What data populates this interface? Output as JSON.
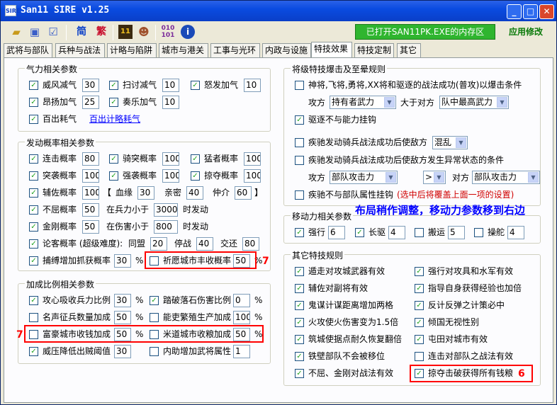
{
  "window": {
    "title": "San11 SIRE v1.25",
    "icon_text": "SIRE"
  },
  "toolbar": {
    "status": "已打开SAN11PK.EXE的内存区",
    "apply_label": "应用修改",
    "icons": [
      "open-folder-icon",
      "save-icon",
      "checklist-icon",
      "simplified-icon",
      "traditional-icon",
      "san11-icon",
      "character-icon",
      "binary-icon",
      "info-icon"
    ],
    "simp_label": "简",
    "trad_label": "繁"
  },
  "tabs": [
    "武将与部队",
    "兵种与战法",
    "计略与陷阱",
    "城市与港关",
    "工事与光环",
    "内政与设施",
    "特技效果",
    "特技定制",
    "其它"
  ],
  "g1": {
    "title": "气力相关参数",
    "row1": [
      {
        "label": "威风减气",
        "value": "30"
      },
      {
        "label": "扫讨减气",
        "value": "10"
      },
      {
        "label": "怒发加气",
        "value": "10"
      }
    ],
    "row2": [
      {
        "label": "昂扬加气",
        "value": "25"
      },
      {
        "label": "奏乐加气",
        "value": "10"
      }
    ],
    "row3": {
      "label": "百出耗气",
      "link": "百出计略耗气"
    }
  },
  "g2": {
    "title": "发动概率相关参数",
    "row1": [
      {
        "label": "连击概率",
        "value": "80"
      },
      {
        "label": "骑突概率",
        "value": "100"
      },
      {
        "label": "猛者概率",
        "value": "100"
      }
    ],
    "row2": [
      {
        "label": "突袭概率",
        "value": "100"
      },
      {
        "label": "强袭概率",
        "value": "100"
      },
      {
        "label": "掠夺概率",
        "value": "100"
      }
    ],
    "row3": {
      "label": "辅佐概率",
      "value": "100",
      "bracket_open": "【",
      "bracket_close": "】",
      "subs": [
        {
          "label": "血缘",
          "value": "30"
        },
        {
          "label": "亲密",
          "value": "40"
        },
        {
          "label": "仲介",
          "value": "60"
        }
      ]
    },
    "row4": {
      "label": "不屈概率",
      "value": "50",
      "cond": "在兵力小于",
      "cond_value": "3000",
      "suffix": "时发动"
    },
    "row5": {
      "label": "金刚概率",
      "value": "50",
      "cond": "在伤害小于",
      "cond_value": "800",
      "suffix": "时发动"
    },
    "row6": {
      "label": "论客概率 (超级难度):",
      "subs": [
        {
          "label": "同盟",
          "value": "20"
        },
        {
          "label": "停战",
          "value": "40"
        },
        {
          "label": "交还",
          "value": "80"
        }
      ]
    },
    "row7": {
      "label": "捕缚增加抓获概率",
      "value": "30",
      "unit": "%"
    },
    "row7b": {
      "label": "祈愿城市丰收概率",
      "value": "50",
      "unit": "%"
    }
  },
  "g3": {
    "title": "加成比例相关参数",
    "rows": [
      [
        {
          "label": "攻心吸收兵力比例",
          "value": "30",
          "unit": "%"
        },
        {
          "label": "踏破落石伤害比例",
          "value": "0",
          "unit": "%"
        }
      ],
      [
        {
          "label": "名声征兵数量加成",
          "value": "50",
          "unit": "%"
        },
        {
          "label": "能吏繁殖生产加成",
          "value": "100",
          "unit": "%"
        }
      ],
      [
        {
          "label": "富豪城市收钱加成",
          "value": "50",
          "unit": "%"
        },
        {
          "label": "米道城市收粮加成",
          "value": "50",
          "unit": "%"
        }
      ],
      [
        {
          "label": "威压降低出贼阈值",
          "value": "30"
        },
        {
          "label": "内助增加武将属性",
          "value": "1"
        }
      ]
    ]
  },
  "g4": {
    "title": "将级特技爆击及至晕规则",
    "r1": "神将,飞将,勇将,XX将和驱逐的战法成功(普攻)以爆击条件",
    "r2": {
      "a": "攻方",
      "a_sel": "持有者武力",
      "b": "大于对方",
      "b_sel": "队中最高武力"
    },
    "r3": "驱逐不与能力挂钩",
    "r4": {
      "label": "疾驰发动骑兵战法成功后使敌方",
      "sel": "混乱"
    },
    "r5": "疾驰发动骑兵战法成功后使敌方发生异常状态的条件",
    "r6": {
      "a": "攻方",
      "a_sel": "部队攻击力",
      "op_sel": ">",
      "b": "对方",
      "b_sel": "部队攻击力"
    },
    "r7": {
      "label": "疾驰不与部队属性挂钩",
      "note": "(选中后将覆盖上面一项的设置)"
    }
  },
  "g5": {
    "title": "移动力相关参数",
    "items": [
      {
        "label": "强行",
        "value": "6"
      },
      {
        "label": "长驱",
        "value": "4"
      },
      {
        "label": "搬运",
        "value": "5"
      },
      {
        "label": "操舵",
        "value": "4"
      }
    ]
  },
  "g6": {
    "title": "其它特技规则",
    "left": [
      "遁走对攻城武器有效",
      "辅佐对副将有效",
      "鬼谋计谋距离增加两格",
      "火攻使火伤害变为1.5倍",
      "筑城使据点耐久恢复翻倍",
      "铁壁部队不会被移位",
      "不屈、金刚对战法有效"
    ],
    "right": [
      "强行对攻具和水军有效",
      "指导自身获得经验也加倍",
      "反计反弹之计策必中",
      "倾国无视性别",
      "屯田对城市有效",
      "连击对部队之战法有效",
      "掠夺击破获得所有钱粮"
    ]
  },
  "annotations": {
    "note": "布局稍作调整，移动力参数移到右边",
    "n6": "6",
    "n7a": "7",
    "n7b": "7"
  }
}
